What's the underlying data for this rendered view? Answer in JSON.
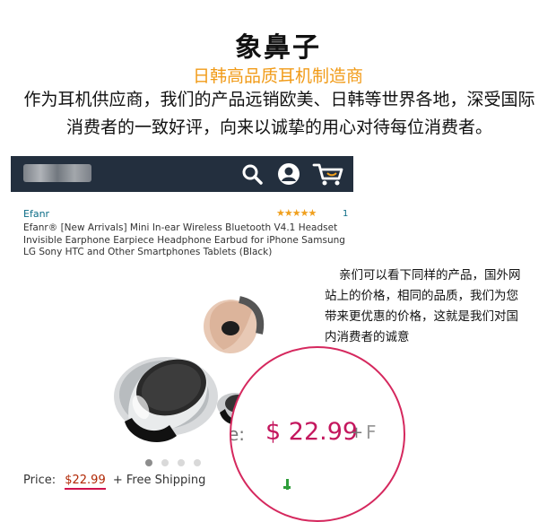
{
  "header": {
    "brand": "象鼻子",
    "subtitle": "日韩高品质耳机制造商",
    "intro": "作为耳机供应商，我们的产品远销欧美、日韩等世界各地，深受国际消费者的一致好评，向来以诚挚的用心对待每位消费者。"
  },
  "app": {
    "header_bg": "#232f3e",
    "icons": [
      "search-icon",
      "account-icon",
      "cart-icon"
    ]
  },
  "product": {
    "seller": "Efanr",
    "rating_stars": "★★★★★",
    "rating": 5,
    "review_count": "1",
    "title": "Efanr® [New Arrivals] Mini In-ear Wireless Bluetooth V4.1 Headset Invisible Earphone Earpiece Headphone Earbud for iPhone Samsung LG Sony HTC and Other Smartphones Tablets (Black)",
    "price_label": "Price:",
    "price": "$22.99",
    "shipping": "+ Free Shipping",
    "carousel": {
      "count": 4,
      "active_index": 0
    }
  },
  "annotation": {
    "line1": "亲们可以看下同样的产品，国外网",
    "line2": "站上的价格，相同的品质，我们为您",
    "line3": "带来更优惠的价格，这就是我们对国",
    "line4": "内消费者的诚意"
  },
  "zoom": {
    "prefix": "e:",
    "price": "$ 22.99",
    "plus": "+",
    "suffix": "F"
  },
  "colors": {
    "subtitle": "#f19b18",
    "accent_circle": "#d5285e",
    "price_pink": "#c4175e",
    "star": "#f0a01e",
    "link": "#0b6c86"
  }
}
